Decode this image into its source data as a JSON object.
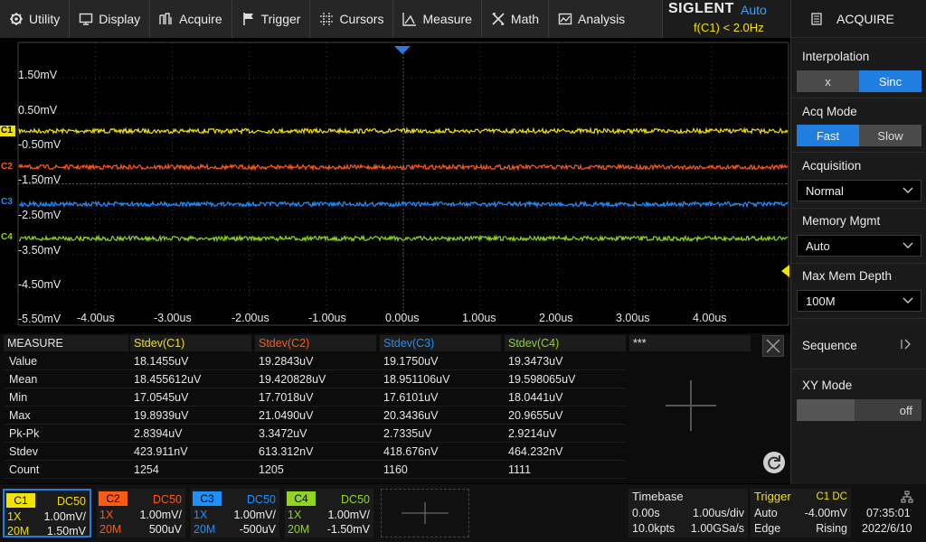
{
  "menu": {
    "items": [
      {
        "label": "Utility",
        "icon": "utility-icon"
      },
      {
        "label": "Display",
        "icon": "display-icon"
      },
      {
        "label": "Acquire",
        "icon": "acquire-icon"
      },
      {
        "label": "Trigger",
        "icon": "trigger-flag-icon"
      },
      {
        "label": "Cursors",
        "icon": "cursors-icon"
      },
      {
        "label": "Measure",
        "icon": "measure-icon"
      },
      {
        "label": "Math",
        "icon": "math-icon"
      },
      {
        "label": "Analysis",
        "icon": "analysis-icon"
      }
    ]
  },
  "brand": {
    "logo": "SIGLENT",
    "mode": "Auto",
    "freq": "f(C1) < 2.0Hz"
  },
  "panel": {
    "title": "ACQUIRE",
    "interpolation": {
      "label": "Interpolation",
      "options": [
        "x",
        "Sinc"
      ],
      "selected": "Sinc"
    },
    "acq_mode": {
      "label": "Acq Mode",
      "options": [
        "Fast",
        "Slow"
      ],
      "selected": "Fast"
    },
    "acquisition": {
      "label": "Acquisition",
      "value": "Normal"
    },
    "memory_mgmt": {
      "label": "Memory Mgmt",
      "value": "Auto"
    },
    "max_mem_depth": {
      "label": "Max Mem Depth",
      "value": "100M"
    },
    "sequence": {
      "label": "Sequence"
    },
    "xy_mode": {
      "label": "XY Mode",
      "value": "off"
    }
  },
  "screen": {
    "y_labels": [
      "1.50mV",
      "0.50mV",
      "-0.50mV",
      "-1.50mV",
      "-2.50mV",
      "-3.50mV",
      "-4.50mV",
      "-5.50mV"
    ],
    "x_labels": [
      "-4.00us",
      "-3.00us",
      "-2.00us",
      "-1.00us",
      "0.00us",
      "1.00us",
      "2.00us",
      "3.00us",
      "4.00us"
    ],
    "channels": [
      {
        "name": "C1",
        "color": "#f2e200"
      },
      {
        "name": "C2",
        "color": "#ff5a12"
      },
      {
        "name": "C3",
        "color": "#1e90ff"
      },
      {
        "name": "C4",
        "color": "#8fd61c"
      }
    ]
  },
  "measure": {
    "title": "MEASURE",
    "columns": [
      {
        "label": "Stdev(C1)",
        "color": "#f2e200"
      },
      {
        "label": "Stdev(C2)",
        "color": "#ff5a12"
      },
      {
        "label": "Stdev(C3)",
        "color": "#1e90ff"
      },
      {
        "label": "Stdev(C4)",
        "color": "#8fd61c"
      }
    ],
    "extra_col": "***",
    "rows": [
      {
        "label": "Value",
        "vals": [
          "18.1455uV",
          "19.2843uV",
          "19.1750uV",
          "19.3473uV"
        ]
      },
      {
        "label": "Mean",
        "vals": [
          "18.455612uV",
          "19.420828uV",
          "18.951106uV",
          "19.598065uV"
        ]
      },
      {
        "label": "Min",
        "vals": [
          "17.0545uV",
          "17.7018uV",
          "17.6101uV",
          "18.0441uV"
        ]
      },
      {
        "label": "Max",
        "vals": [
          "19.8939uV",
          "21.0490uV",
          "20.3436uV",
          "20.9655uV"
        ]
      },
      {
        "label": "Pk-Pk",
        "vals": [
          "2.8394uV",
          "3.3472uV",
          "2.7335uV",
          "2.9214uV"
        ]
      },
      {
        "label": "Stdev",
        "vals": [
          "423.911nV",
          "613.312nV",
          "418.676nV",
          "464.232nV"
        ]
      },
      {
        "label": "Count",
        "vals": [
          "1254",
          "1205",
          "1160",
          "1111"
        ]
      }
    ]
  },
  "bottom": {
    "channels": [
      {
        "name": "C1",
        "coupling": "DC50",
        "probe": "1X",
        "scale": "1.00mV/",
        "bw": "20M",
        "offset": "1.50mV"
      },
      {
        "name": "C2",
        "coupling": "DC50",
        "probe": "1X",
        "scale": "1.00mV/",
        "bw": "20M",
        "offset": "500uV"
      },
      {
        "name": "C3",
        "coupling": "DC50",
        "probe": "1X",
        "scale": "1.00mV/",
        "bw": "20M",
        "offset": "-500uV"
      },
      {
        "name": "C4",
        "coupling": "DC50",
        "probe": "1X",
        "scale": "1.00mV/",
        "bw": "20M",
        "offset": "-1.50mV"
      }
    ],
    "timebase": {
      "title": "Timebase",
      "delay": "0.00s",
      "scale": "1.00us/div",
      "points": "10.0kpts",
      "rate": "1.00GSa/s"
    },
    "trigger": {
      "title": "Trigger",
      "source": "C1 DC",
      "mode": "Auto",
      "level": "-4.00mV",
      "type": "Edge",
      "slope": "Rising"
    },
    "clock": {
      "time": "07:35:01",
      "date": "2022/6/10"
    }
  }
}
